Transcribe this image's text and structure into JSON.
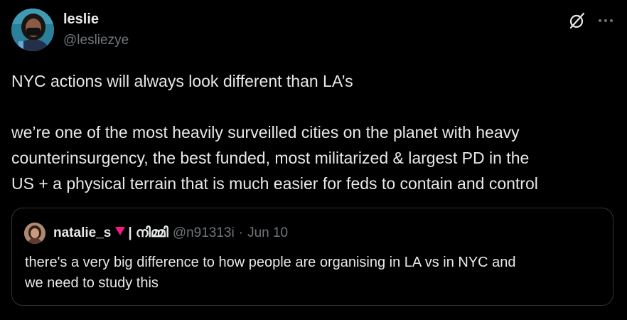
{
  "author": {
    "name": "leslie",
    "handle": "@lesliezye"
  },
  "icons": {
    "avatar": "avatar-photo",
    "grok": "grok-slash-icon",
    "more": "more-horizontal-icon"
  },
  "tweet": {
    "lines": [
      "NYC actions will always look different than LA’s",
      "we’re one of the most heavily surveilled cities on the planet with heavy",
      "counterinsurgency, the best funded, most militarized & largest PD in the",
      "US + a physical terrain that is much easier for feds to contain and control"
    ]
  },
  "quote": {
    "name": "natalie_s",
    "separator": "| നിമ്മി",
    "handle": "@n91313i",
    "dot": "·",
    "date": "Jun 10",
    "lines": [
      "there's a very big difference to how people are organising in LA vs in NYC and",
      "we need to study this"
    ]
  },
  "colors": {
    "background": "#000000",
    "text": "#e7e9ea",
    "muted": "#71767b",
    "border": "#2f3336",
    "heart": "#f91880"
  }
}
